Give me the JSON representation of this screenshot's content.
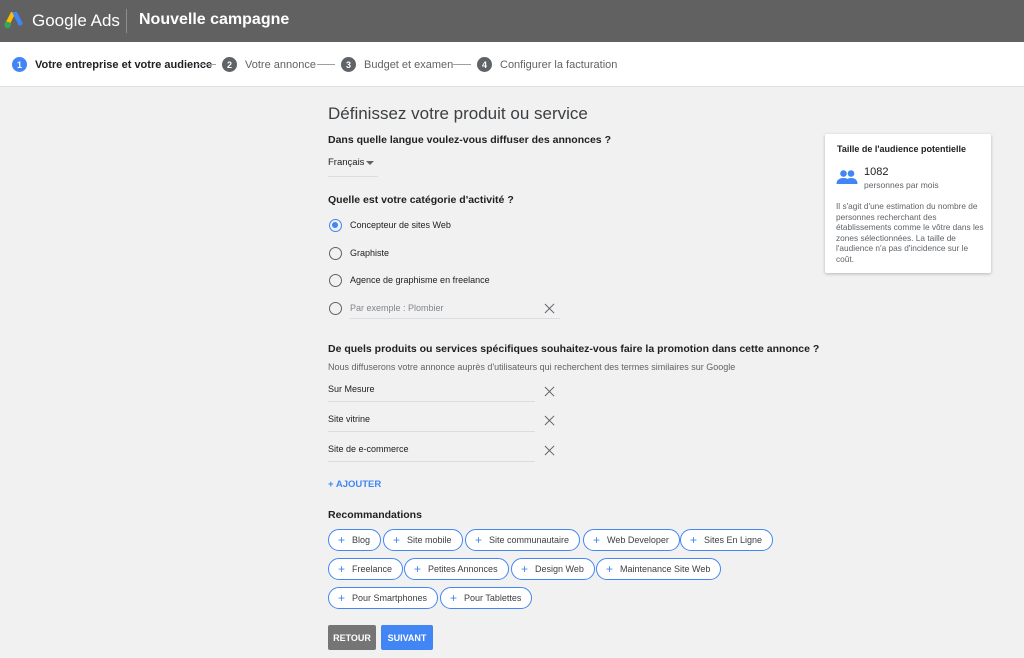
{
  "header": {
    "brand": "Google Ads",
    "title": "Nouvelle campagne"
  },
  "stepper": {
    "steps": [
      {
        "num": "1",
        "label": "Votre entreprise et votre audience",
        "active": true
      },
      {
        "num": "2",
        "label": "Votre annonce",
        "active": false
      },
      {
        "num": "3",
        "label": "Budget et examen",
        "active": false
      },
      {
        "num": "4",
        "label": "Configurer la facturation",
        "active": false
      }
    ]
  },
  "main": {
    "title": "Définissez votre produit ou service",
    "language": {
      "question": "Dans quelle langue voulez-vous diffuser des annonces ?",
      "selected": "Français"
    },
    "category": {
      "question": "Quelle est votre catégorie d'activité ?",
      "options": [
        {
          "label": "Concepteur de sites Web",
          "checked": true
        },
        {
          "label": "Graphiste",
          "checked": false
        },
        {
          "label": "Agence de graphisme en freelance",
          "checked": false
        }
      ],
      "custom_placeholder": "Par exemple : Plombier"
    },
    "products": {
      "question": "De quels produits ou services spécifiques souhaitez-vous faire la promotion dans cette annonce ?",
      "hint": "Nous diffuserons votre annonce auprès d'utilisateurs qui recherchent des termes similaires sur Google",
      "keywords": [
        "Sur Mesure",
        "Site vitrine",
        "Site de e-commerce"
      ],
      "add_label": "+ AJOUTER"
    },
    "recommendations": {
      "title": "Recommandations",
      "chips": [
        "Blog",
        "Site mobile",
        "Site communautaire",
        "Web Developer",
        "Sites En Ligne",
        "Freelance",
        "Petites Annonces",
        "Design Web",
        "Maintenance Site Web",
        "Pour Smartphones",
        "Pour Tablettes"
      ]
    },
    "buttons": {
      "back": "RETOUR",
      "next": "SUIVANT"
    }
  },
  "audience": {
    "title": "Taille de l'audience potentielle",
    "count": "1082",
    "unit": "personnes par mois",
    "description": "Il s'agit d'une estimation du nombre de personnes recherchant des établissements comme le vôtre dans les zones sélectionnées. La taille de l'audience n'a pas d'incidence sur le coût."
  },
  "colors": {
    "accent": "#4285f4",
    "header_bg": "#616161",
    "page_bg": "#f1f1f1"
  }
}
